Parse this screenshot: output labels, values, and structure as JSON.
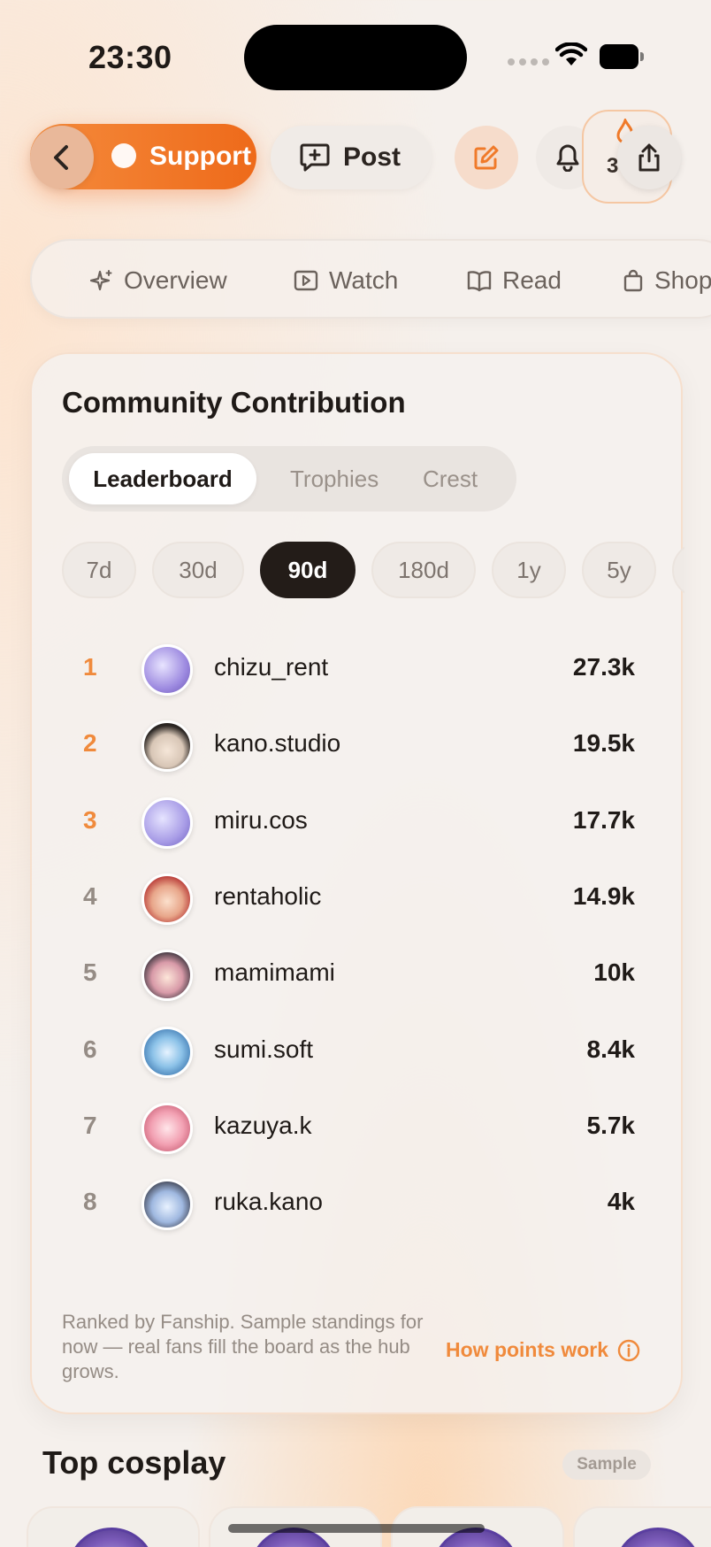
{
  "status": {
    "time": "23:30"
  },
  "actions": {
    "support_label": "Support",
    "post_label": "Post",
    "badge_count": "3"
  },
  "tabs": [
    {
      "label": "Overview",
      "icon": "sparkle-icon"
    },
    {
      "label": "Watch",
      "icon": "play-icon"
    },
    {
      "label": "Read",
      "icon": "book-icon"
    },
    {
      "label": "Shop",
      "icon": "bag-icon"
    }
  ],
  "contribution": {
    "title": "Community Contribution",
    "segments": [
      "Leaderboard",
      "Trophies",
      "Crest"
    ],
    "active_segment": "Leaderboard",
    "periods": [
      "7d",
      "30d",
      "90d",
      "180d",
      "1y",
      "5y"
    ],
    "active_period": "90d",
    "leaderboard": [
      {
        "rank": "1",
        "name": "chizu_rent",
        "score": "27.3k"
      },
      {
        "rank": "2",
        "name": "kano.studio",
        "score": "19.5k"
      },
      {
        "rank": "3",
        "name": "miru.cos",
        "score": "17.7k"
      },
      {
        "rank": "4",
        "name": "rentaholic",
        "score": "14.9k"
      },
      {
        "rank": "5",
        "name": "mamimami",
        "score": "10k"
      },
      {
        "rank": "6",
        "name": "sumi.soft",
        "score": "8.4k"
      },
      {
        "rank": "7",
        "name": "kazuya.k",
        "score": "5.7k"
      },
      {
        "rank": "8",
        "name": "ruka.kano",
        "score": "4k"
      }
    ],
    "footnote": "Ranked by Fanship. Sample standings for now — real fans fill the board as the hub grows.",
    "how_link": "How points work"
  },
  "cosplay": {
    "title": "Top cosplay",
    "badge": "Sample"
  },
  "colors": {
    "accent": "#ee6a1a",
    "top_rank": "#f08a3c",
    "other_rank": "#958c85",
    "dark_pill": "#231c18"
  }
}
